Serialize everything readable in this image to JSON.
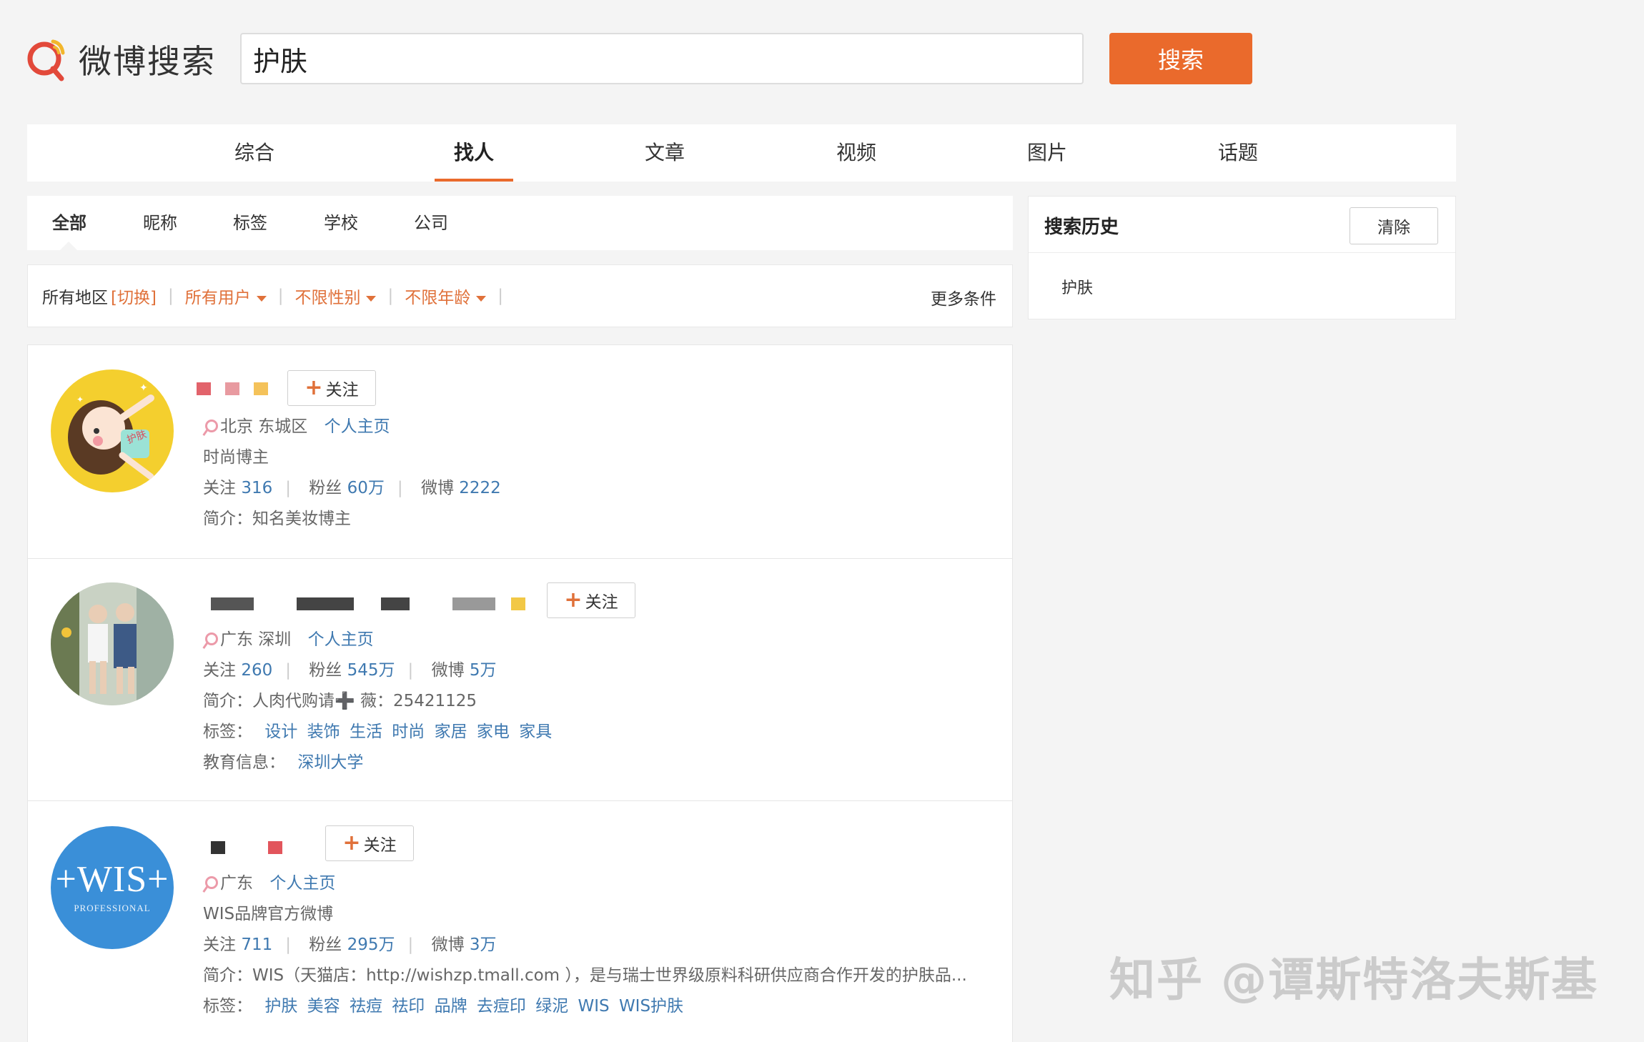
{
  "header": {
    "logo_text": "微博搜索",
    "search_value": "护肤",
    "search_button": "搜索"
  },
  "main_tabs": [
    "综合",
    "找人",
    "文章",
    "视频",
    "图片",
    "话题"
  ],
  "sub_tabs": [
    "全部",
    "昵称",
    "标签",
    "学校",
    "公司"
  ],
  "filters": {
    "region": "所有地区",
    "switch": "[切换]",
    "users": "所有用户",
    "gender": "不限性别",
    "age": "不限年龄",
    "more": "更多条件"
  },
  "results": [
    {
      "follow": "关注",
      "location": "北京 东城区",
      "homepage": "个人主页",
      "title": "时尚博主",
      "following_label": "关注",
      "following": "316",
      "fans_label": "粉丝",
      "fans": "60万",
      "weibo_label": "微博",
      "weibo": "2222",
      "bio_label": "简介：",
      "bio": "知名美妆博主",
      "avatar_text": "护肤"
    },
    {
      "follow": "关注",
      "location": "广东 深圳",
      "homepage": "个人主页",
      "following_label": "关注",
      "following": "260",
      "fans_label": "粉丝",
      "fans": "545万",
      "weibo_label": "微博",
      "weibo": "5万",
      "bio_label": "简介：",
      "bio": "人肉代购请➕ 薇：25421125",
      "tags_label": "标签：",
      "tags": [
        "设计",
        "装饰",
        "生活",
        "时尚",
        "家居",
        "家电",
        "家具"
      ],
      "edu_label": "教育信息：",
      "edu": "深圳大学"
    },
    {
      "follow": "关注",
      "location": "广东",
      "homepage": "个人主页",
      "title": "WIS品牌官方微博",
      "following_label": "关注",
      "following": "711",
      "fans_label": "粉丝",
      "fans": "295万",
      "weibo_label": "微博",
      "weibo": "3万",
      "bio_label": "简介：",
      "bio": "WIS（天猫店：http://wishzp.tmall.com ），是与瑞士世界级原料科研供应商合作开发的护肤品...",
      "tags_label": "标签：",
      "tags": [
        "护肤",
        "美容",
        "祛痘",
        "祛印",
        "品牌",
        "去痘印",
        "绿泥",
        "WIS",
        "WIS护肤"
      ],
      "avatar_text": "+WIS+",
      "avatar_sub": "PROFESSIONAL"
    }
  ],
  "sidebar": {
    "history_title": "搜索历史",
    "clear": "清除",
    "items": [
      "护肤"
    ]
  },
  "watermark": "知乎 @谭斯特洛夫斯基",
  "colors": {
    "accent": "#ea6a2c",
    "link": "#3f79b0"
  }
}
